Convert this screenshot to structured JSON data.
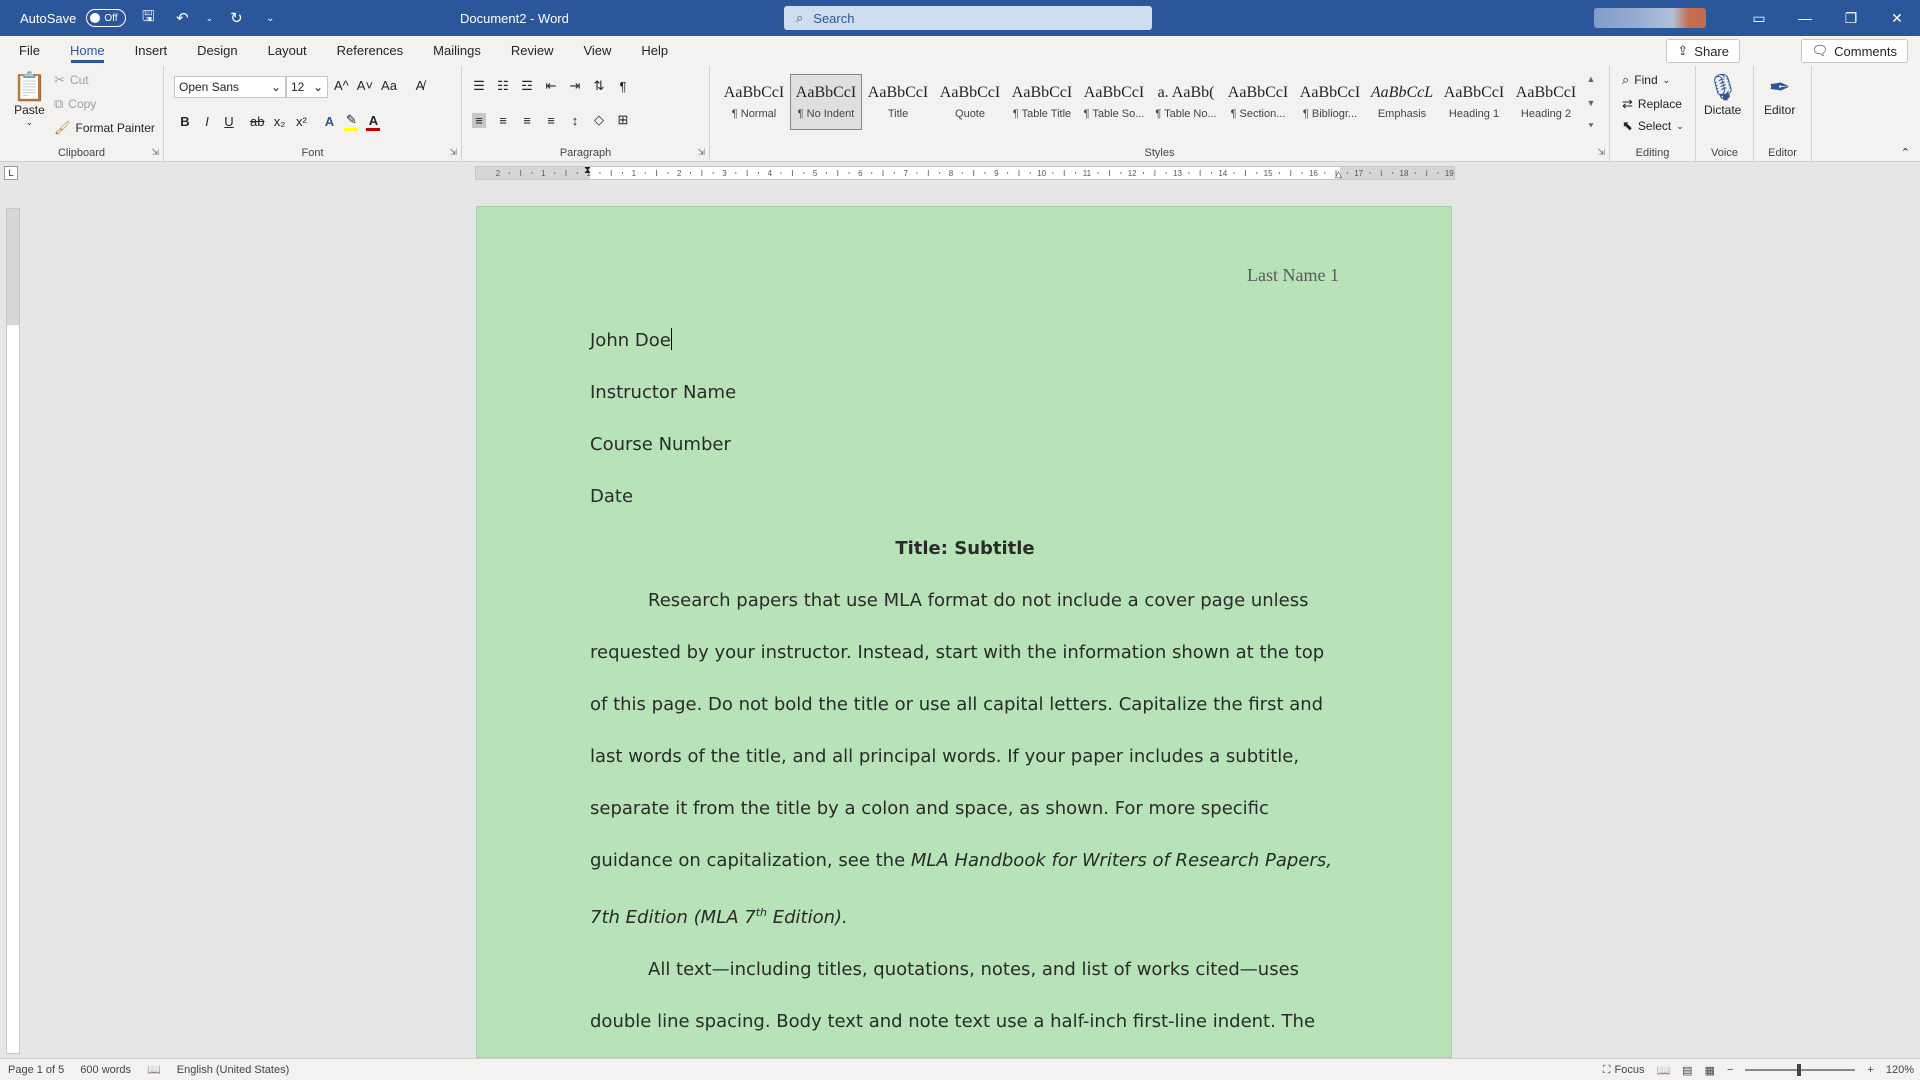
{
  "titlebar": {
    "autosave_label": "AutoSave",
    "autosave_state": "Off",
    "doc_title": "Document2 - Word",
    "search_placeholder": "Search",
    "qat_icons": [
      "save-icon",
      "undo-icon",
      "redo-icon",
      "customize-qat-icon"
    ]
  },
  "tabs": [
    "File",
    "Home",
    "Insert",
    "Design",
    "Layout",
    "References",
    "Mailings",
    "Review",
    "View",
    "Help"
  ],
  "active_tab": "Home",
  "share_label": "Share",
  "comments_label": "Comments",
  "clipboard": {
    "paste": "Paste",
    "cut": "Cut",
    "copy": "Copy",
    "format_painter": "Format Painter",
    "label": "Clipboard"
  },
  "font": {
    "name": "Open Sans",
    "size": "12",
    "label": "Font",
    "buttons": [
      "B",
      "I",
      "U",
      "ab",
      "x₂",
      "x²"
    ],
    "grow": "A^",
    "shrink": "A˅",
    "case": "Aa",
    "text_effects": "A",
    "font_color": "A"
  },
  "paragraph": {
    "label": "Paragraph",
    "pilcrow": "¶"
  },
  "styles": {
    "label": "Styles",
    "items": [
      {
        "preview": "AaBbCcI",
        "name": "¶ Normal"
      },
      {
        "preview": "AaBbCcI",
        "name": "¶ No Indent"
      },
      {
        "preview": "AaBbCcI",
        "name": "Title"
      },
      {
        "preview": "AaBbCcI",
        "name": "Quote"
      },
      {
        "preview": "AaBbCcI",
        "name": "¶ Table Title"
      },
      {
        "preview": "AaBbCcI",
        "name": "¶ Table So..."
      },
      {
        "preview": "a. AaBb(",
        "name": "¶ Table No..."
      },
      {
        "preview": "AaBbCcI",
        "name": "¶ Section..."
      },
      {
        "preview": "AaBbCcI",
        "name": "¶ Bibliogr..."
      },
      {
        "preview": "AaBbCcL",
        "name": "Emphasis"
      },
      {
        "preview": "AaBbCcI",
        "name": "Heading 1"
      },
      {
        "preview": "AaBbCcI",
        "name": "Heading 2"
      }
    ],
    "selected_index": 1
  },
  "editing": {
    "label": "Editing",
    "find": "Find",
    "replace": "Replace",
    "select": "Select"
  },
  "voice": {
    "label": "Voice",
    "dictate": "Dictate"
  },
  "editor": {
    "label": "Editor",
    "editor": "Editor"
  },
  "ruler_numbers": [
    "2",
    "1",
    "1",
    "1",
    "2",
    "3",
    "4",
    "5",
    "6",
    "7",
    "8",
    "9",
    "10",
    "11",
    "12",
    "13",
    "14",
    "15",
    "16",
    "17",
    "18",
    "19"
  ],
  "document": {
    "header": "Last Name 1",
    "lines": {
      "name": "John Doe",
      "instructor": "Instructor Name",
      "course": "Course Number",
      "date": "Date",
      "title": "Title: Subtitle",
      "p1_a": "Research papers that use MLA format do not include a cover page unless requested by your instructor. Instead, start with the information shown at the top of this page.  Do not bold the title or use all capital letters. Capitalize the first and last words of the title, and all principal words. If your paper includes a subtitle, separate it from the title by a colon and space, as shown. For more specific guidance on capitalization, see the ",
      "p1_italic": "MLA Handbook for Writers of Research Papers, 7th Edition (MLA 7",
      "p1_sup": "th",
      "p1_italic_end": " Edition).",
      "p2": "All text—including titles, quotations, notes, and list of works cited—uses double line spacing. Body text and note text use a half-inch first-line indent. The list"
    },
    "page_color": "#b8e3b9"
  },
  "status": {
    "page": "Page 1 of 5",
    "words": "600 words",
    "language": "English (United States)",
    "focus": "Focus",
    "zoom": "120%"
  }
}
